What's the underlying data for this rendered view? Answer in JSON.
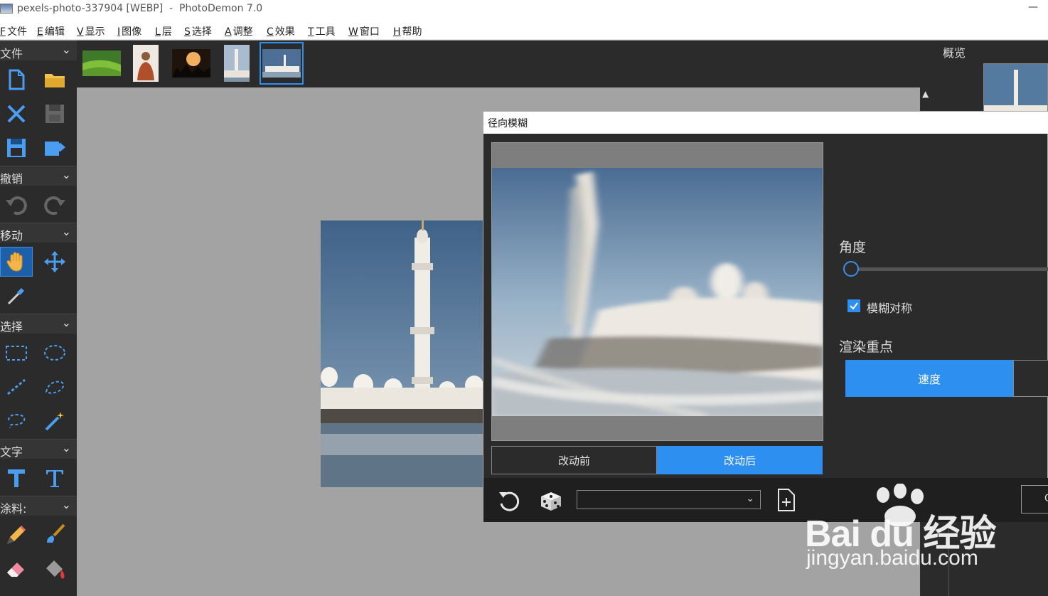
{
  "window": {
    "title": "pexels-photo-337904 [WEBP]  -  PhotoDemon 7.0",
    "minimize": "—"
  },
  "menu": [
    {
      "key": "F",
      "label": "文件"
    },
    {
      "key": "E",
      "label": "编辑"
    },
    {
      "key": "V",
      "label": "显示"
    },
    {
      "key": "I",
      "label": "图像"
    },
    {
      "key": "L",
      "label": "层"
    },
    {
      "key": "S",
      "label": "选择"
    },
    {
      "key": "A",
      "label": "调整"
    },
    {
      "key": "C",
      "label": "效果"
    },
    {
      "key": "T",
      "label": "工具"
    },
    {
      "key": "W",
      "label": "窗口"
    },
    {
      "key": "H",
      "label": "帮助"
    }
  ],
  "toolbox": {
    "sections": [
      "文件",
      "撤销",
      "移动",
      "选择",
      "文字",
      "涂料:"
    ],
    "chevron": "⌄"
  },
  "right_panel": {
    "overview_label": "概览"
  },
  "canvas": {
    "scroll_up": "▲"
  },
  "dialog": {
    "title": "径向模糊",
    "before_label": "改动前",
    "after_label": "改动后",
    "angle_label": "角度",
    "angle_value": 0,
    "symmetric_label": "模糊对称",
    "symmetric_checked": true,
    "render_focus_label": "渲染重点",
    "speed_label": "速度",
    "preset_value": "",
    "preset_chevron": "⌄",
    "ok_label": "O"
  },
  "watermark": {
    "brand": "Bai  du",
    "cn": "经验",
    "url": "jingyan.baidu.com"
  },
  "colors": {
    "accent": "#2d8fef",
    "panel": "#2b2b2b",
    "canvas": "#a3a3a3"
  }
}
